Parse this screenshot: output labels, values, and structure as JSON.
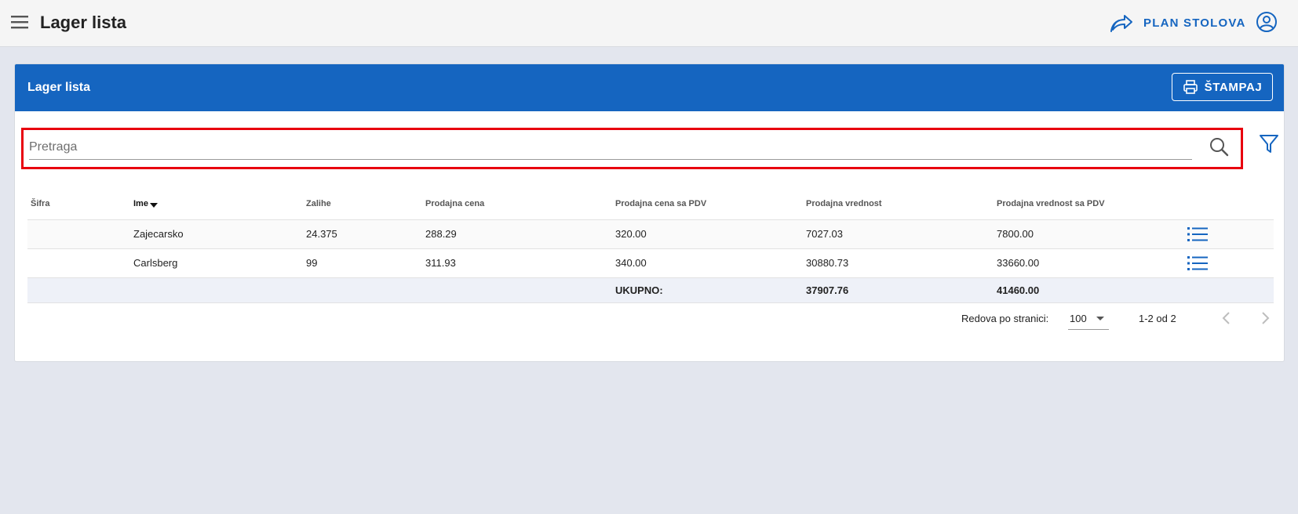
{
  "app": {
    "title": "Lager lista",
    "plan_button_label": "PLAN STOLOVA"
  },
  "icons": {
    "menu": "hamburger-menu-icon",
    "plan": "share-arrow-icon",
    "account": "account-circle-icon",
    "print": "printer-icon",
    "search": "search-icon",
    "filter": "filter-icon",
    "details": "list-icon",
    "prev": "chevron-left-icon",
    "next": "chevron-right-icon"
  },
  "colors": {
    "primary": "#1565c0",
    "highlight_border": "#e8000e"
  },
  "card": {
    "title": "Lager lista",
    "print_label": "ŠTAMPAJ"
  },
  "search": {
    "placeholder": "Pretraga",
    "value": ""
  },
  "table": {
    "columns": [
      "Šifra",
      "Ime",
      "Zalihe",
      "Prodajna cena",
      "Prodajna cena sa PDV",
      "Prodajna vrednost",
      "Prodajna vrednost sa PDV"
    ],
    "sorted_column": "Ime",
    "rows": [
      {
        "sifra": "",
        "ime": "Zajecarsko",
        "zalihe": "24.375",
        "cena": "288.29",
        "cena_pdv": "320.00",
        "vrednost": "7027.03",
        "vrednost_pdv": "7800.00"
      },
      {
        "sifra": "",
        "ime": "Carlsberg",
        "zalihe": "99",
        "cena": "311.93",
        "cena_pdv": "340.00",
        "vrednost": "30880.73",
        "vrednost_pdv": "33660.00"
      }
    ],
    "total": {
      "label": "UKUPNO:",
      "vrednost": "37907.76",
      "vrednost_pdv": "41460.00"
    }
  },
  "pagination": {
    "rows_per_page_label": "Redova po stranici:",
    "rows_per_page": "100",
    "range": "1-2 od 2"
  }
}
